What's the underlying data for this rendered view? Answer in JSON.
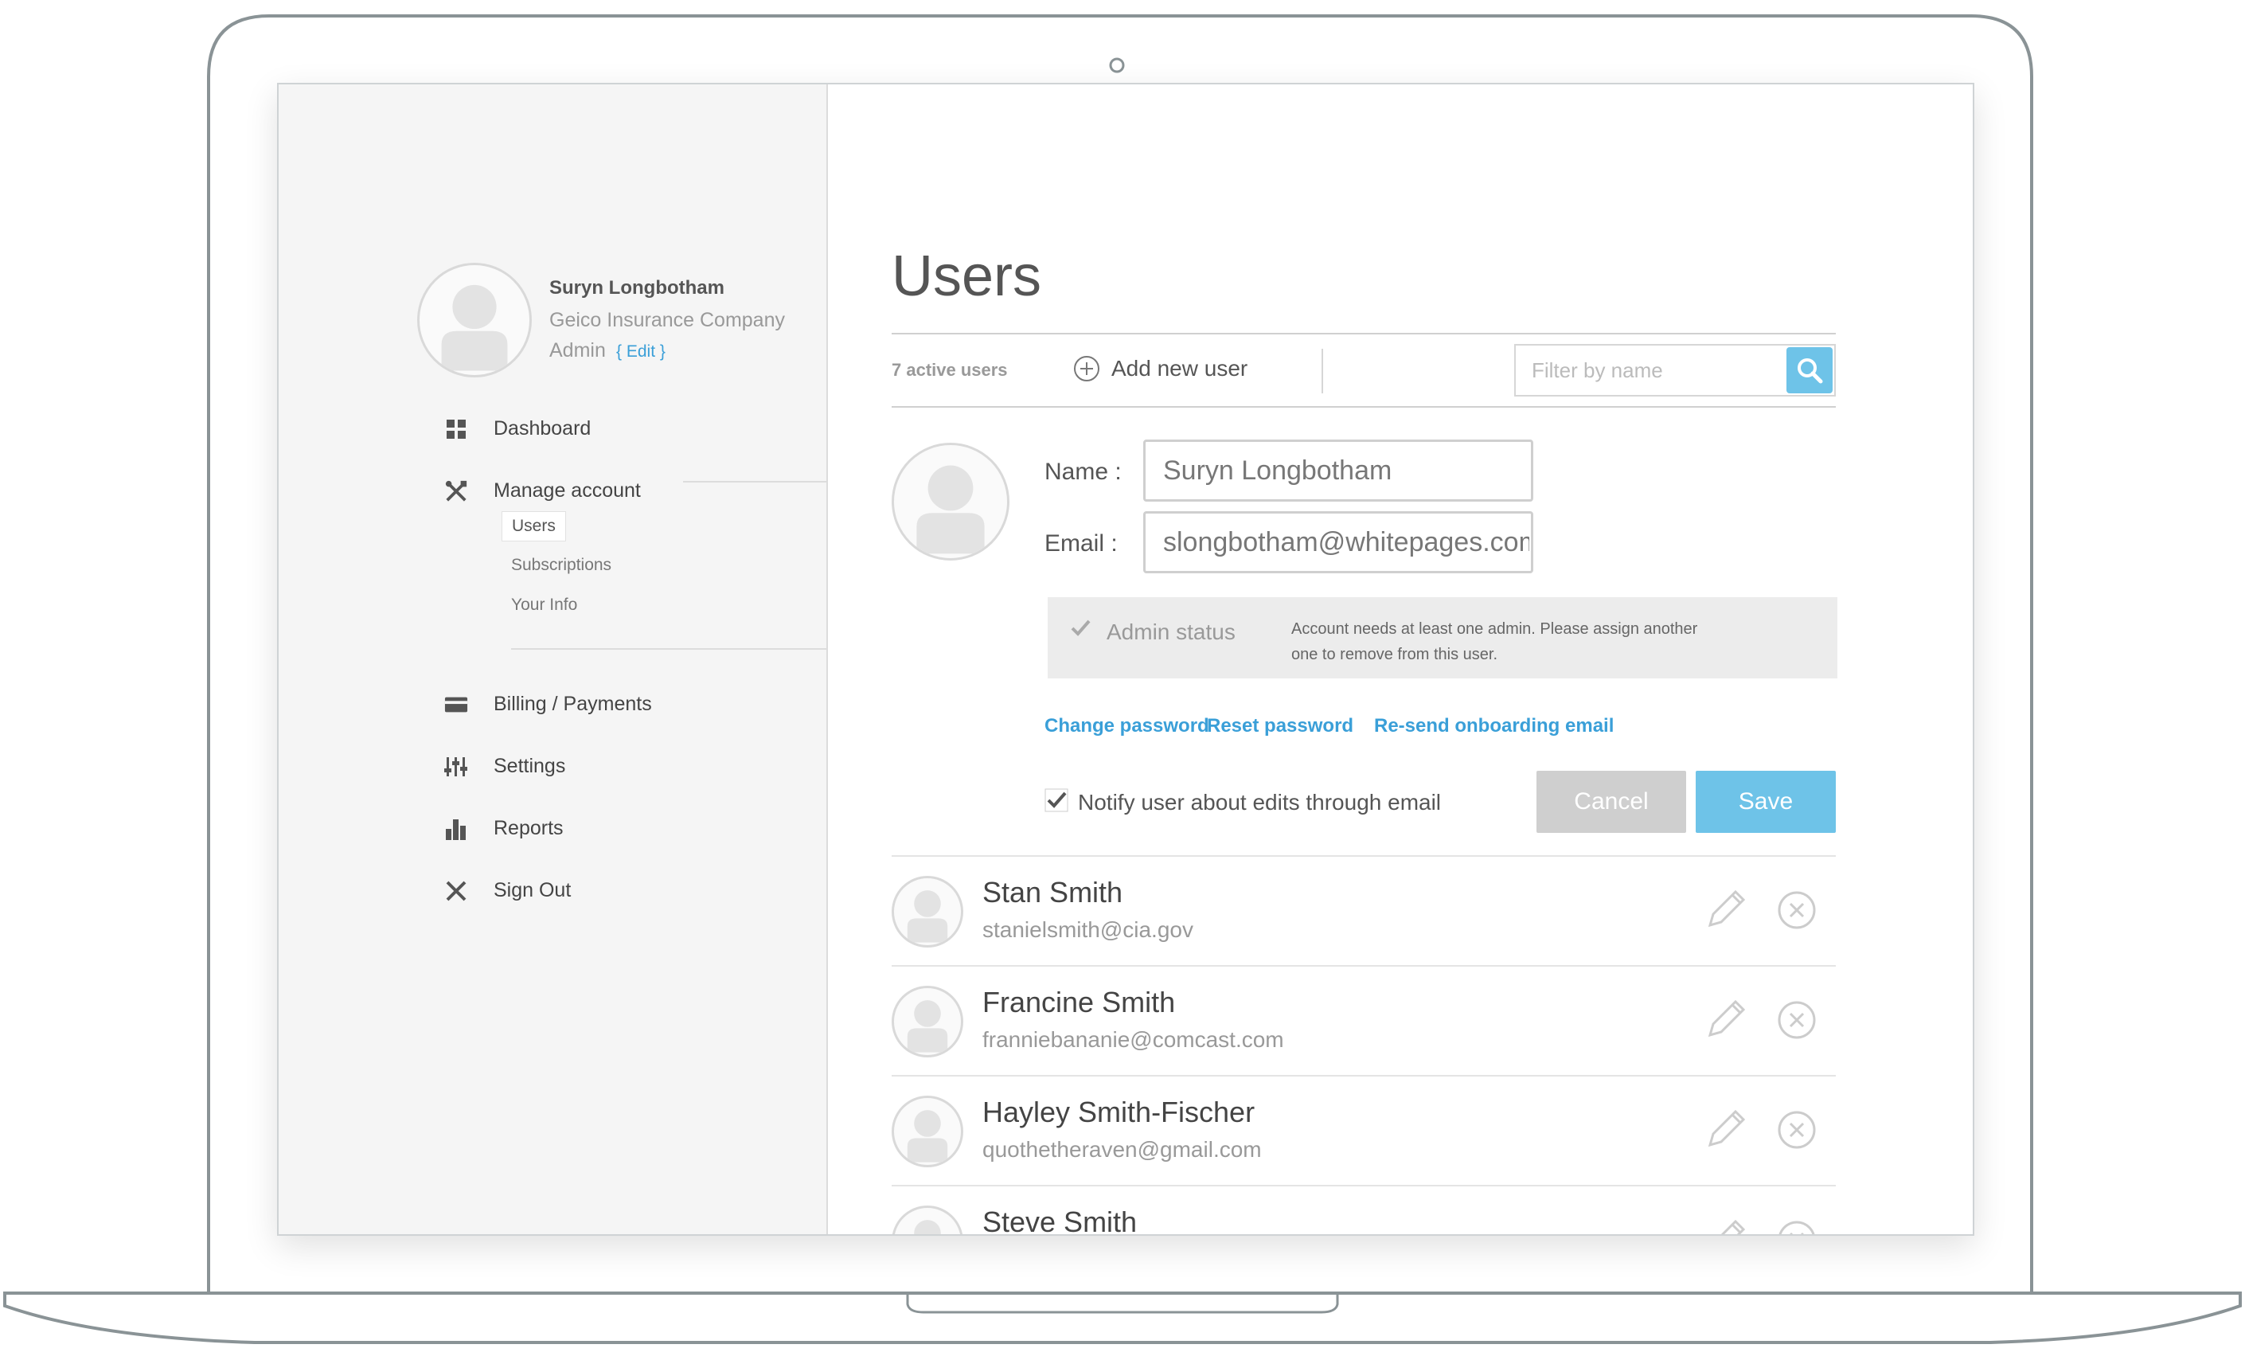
{
  "sidebar": {
    "profile": {
      "name": "Suryn Longbotham",
      "company": "Geico Insurance Company",
      "role": "Admin",
      "edit_label": "{ Edit }"
    },
    "nav": {
      "dashboard": "Dashboard",
      "manage_account": "Manage account",
      "billing": "Billing / Payments",
      "settings": "Settings",
      "reports": "Reports",
      "sign_out": "Sign Out"
    },
    "submenu": {
      "users": "Users",
      "subscriptions": "Subscriptions",
      "your_info": "Your Info"
    }
  },
  "main": {
    "title": "Users",
    "active_count": "7 active users",
    "add_user_label": "Add new user",
    "filter_placeholder": "Filter by name",
    "edit_form": {
      "name_label": "Name :",
      "name_value": "Suryn Longbotham",
      "email_label": "Email :",
      "email_value": "slongbotham@whitepages.com",
      "admin_label": "Admin status",
      "admin_note": "Account needs at least one admin. Please assign another one to remove from this user.",
      "links": {
        "change_password": "Change password",
        "reset_password": "Reset password",
        "resend_onboarding": "Re-send onboarding email"
      },
      "notify_label": "Notify user about edits through email",
      "cancel_label": "Cancel",
      "save_label": "Save"
    },
    "users": [
      {
        "name": "Stan Smith",
        "email": "stanielsmith@cia.gov"
      },
      {
        "name": "Francine Smith",
        "email": "franniebananie@comcast.com"
      },
      {
        "name": "Hayley Smith-Fischer",
        "email": "quothetheraven@gmail.com"
      },
      {
        "name": "Steve Smith",
        "email": ""
      }
    ]
  },
  "colors": {
    "accent": "#3a9fd8",
    "button_primary": "#6ec3e8",
    "button_disabled": "#cfcfcf",
    "sidebar_bg": "#f5f5f5"
  },
  "icons": {
    "dashboard": "dashboard-grid-icon",
    "manage_account": "tools-icon",
    "billing": "credit-card-icon",
    "settings": "sliders-icon",
    "reports": "bar-chart-icon",
    "sign_out": "close-x-icon",
    "add_user": "plus-circle-icon",
    "search": "search-icon",
    "edit": "pencil-icon",
    "remove": "remove-circle-icon"
  }
}
